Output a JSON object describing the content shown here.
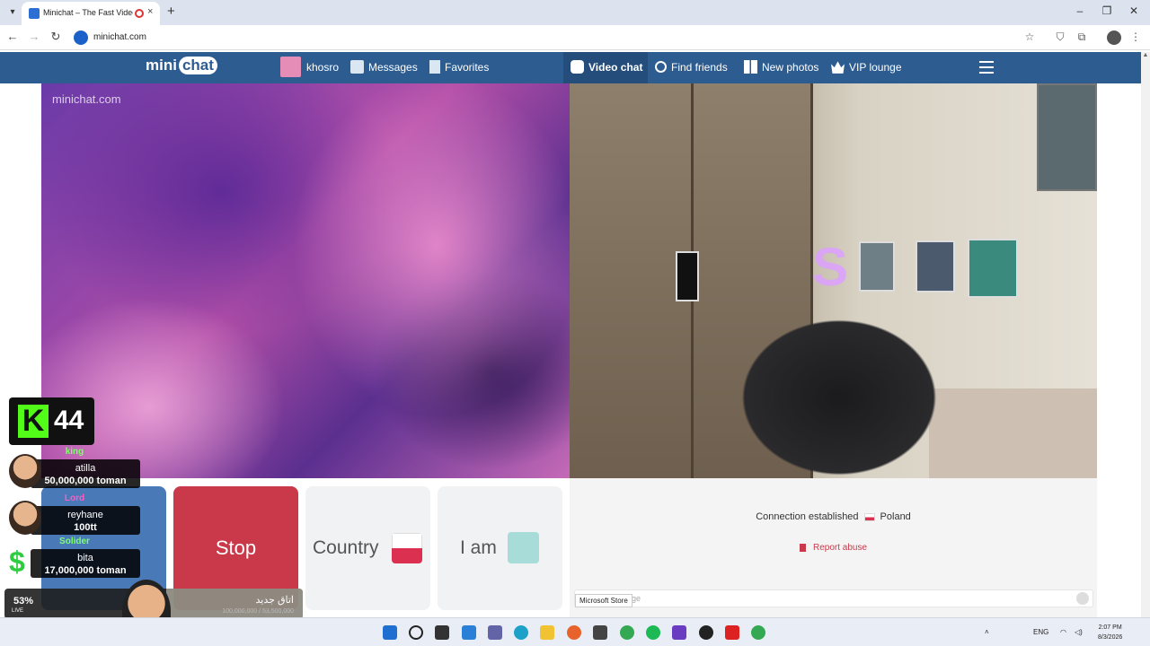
{
  "browser": {
    "tab_title": "Minichat – The Fast Video Ch",
    "url": "minichat.com",
    "new_tab_glyph": "+",
    "tab_close_glyph": "×"
  },
  "site_nav": {
    "logo_mini": "mini",
    "logo_chat": "chat",
    "username": "khosro",
    "messages": "Messages",
    "favorites": "Favorites",
    "video_chat": "Video chat",
    "find_friends": "Find friends",
    "new_photos": "New photos",
    "vip_lounge": "VIP lounge"
  },
  "video": {
    "watermark": "minichat.com"
  },
  "controls": {
    "stop_label": "Stop",
    "country_label": "Country",
    "iam_label": "I am"
  },
  "status": {
    "connection_text": "Connection established",
    "country": "Poland",
    "report_label": "Report abuse",
    "message_placeholder_visible": "age",
    "tooltip": "Microsoft Store"
  },
  "overlay": {
    "viewer_count": "44",
    "kick_letter": "K",
    "donors": [
      {
        "rank": "king",
        "name": "atilla",
        "amount": "50,000,000 toman"
      },
      {
        "rank": "Lord",
        "name": "reyhane",
        "amount": "100tt"
      },
      {
        "rank": "Solider",
        "name": "bita",
        "amount": "17,000,000 toman"
      }
    ],
    "goal_percent": "53%",
    "goal_title": "اتاق جدید",
    "goal_progress_text": "100,000,000 / 53,500,000",
    "live_label": "LIVE"
  },
  "taskbar": {
    "lang": "ENG",
    "time": "2:07 PM",
    "date": "8/3/2026"
  },
  "colors": {
    "nav_bg": "#2d5c91",
    "stop_red": "#c9394a",
    "kick_green": "#53fc18"
  }
}
